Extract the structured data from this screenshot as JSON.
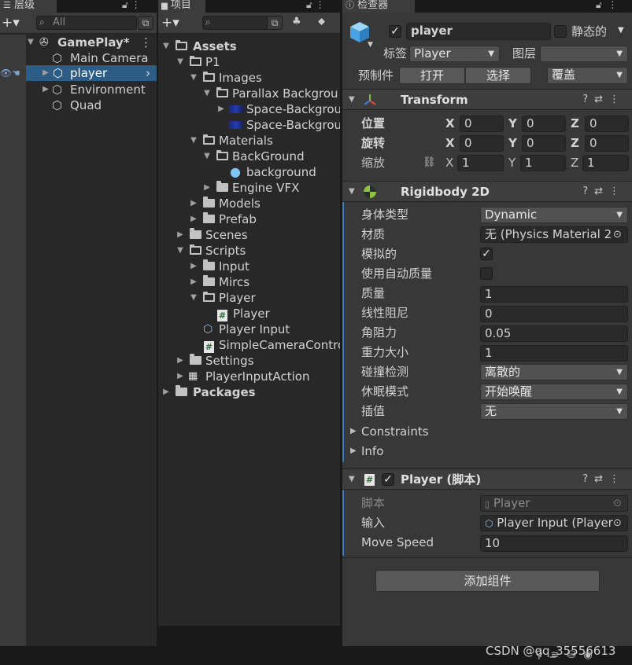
{
  "hierarchy": {
    "tab_label": "层级",
    "add_label": "+▾",
    "search_placeholder": "All",
    "scene": "GamePlay*",
    "items": [
      "Main Camera",
      "player",
      "Environment",
      "Quad"
    ]
  },
  "project": {
    "tab_label": "项目",
    "add_label": "+▾",
    "search_placeholder": "",
    "tree": [
      "Assets",
      "P1",
      "Images",
      "Parallax Backgrou",
      "Space-Backgrou",
      "Space-Backgrou",
      "Materials",
      "BackGround",
      "background",
      "Engine VFX",
      "Models",
      "Prefab",
      "Scenes",
      "Scripts",
      "Input",
      "Mircs",
      "Player",
      "Player",
      "Player Input",
      "SimpleCameraContro",
      "Settings",
      "PlayerInputAction",
      "Packages"
    ]
  },
  "inspector": {
    "tab_label": "检查器",
    "object_name": "player",
    "static_label": "静态的",
    "tag_label": "标签",
    "tag_value": "Player",
    "layer_label": "图层",
    "layer_value": "",
    "prefab_label": "预制件",
    "open_label": "打开",
    "select_label": "选择",
    "overrides_label": "覆盖",
    "transform": {
      "title": "Transform",
      "position_label": "位置",
      "rotation_label": "旋转",
      "scale_label": "缩放",
      "x": "X",
      "y": "Y",
      "z": "Z",
      "position": [
        "0",
        "0",
        "0"
      ],
      "rotation": [
        "0",
        "0",
        "0"
      ],
      "scale": [
        "1",
        "1",
        "1"
      ]
    },
    "rigidbody": {
      "title": "Rigidbody 2D",
      "body_type_label": "身体类型",
      "body_type": "Dynamic",
      "material_label": "材质",
      "material": "无 (Physics Material 2",
      "simulated_label": "模拟的",
      "simulated": true,
      "auto_mass_label": "使用自动质量",
      "auto_mass": false,
      "mass_label": "质量",
      "mass": "1",
      "linear_drag_label": "线性阻尼",
      "linear_drag": "0",
      "angular_drag_label": "角阻力",
      "angular_drag": "0.05",
      "gravity_label": "重力大小",
      "gravity": "1",
      "collision_label": "碰撞检测",
      "collision": "离散的",
      "sleep_label": "休眠模式",
      "sleep": "开始唤醒",
      "interp_label": "插值",
      "interp": "无",
      "constraints_label": "Constraints",
      "info_label": "Info"
    },
    "player_script": {
      "title": "Player  (脚本)",
      "script_label": "脚本",
      "script_value": "Player",
      "input_label": "输入",
      "input_value": "Player Input (Player",
      "move_speed_label": "Move Speed",
      "move_speed": "10"
    },
    "add_component_label": "添加组件"
  },
  "watermark": "CSDN @qq_35556613"
}
